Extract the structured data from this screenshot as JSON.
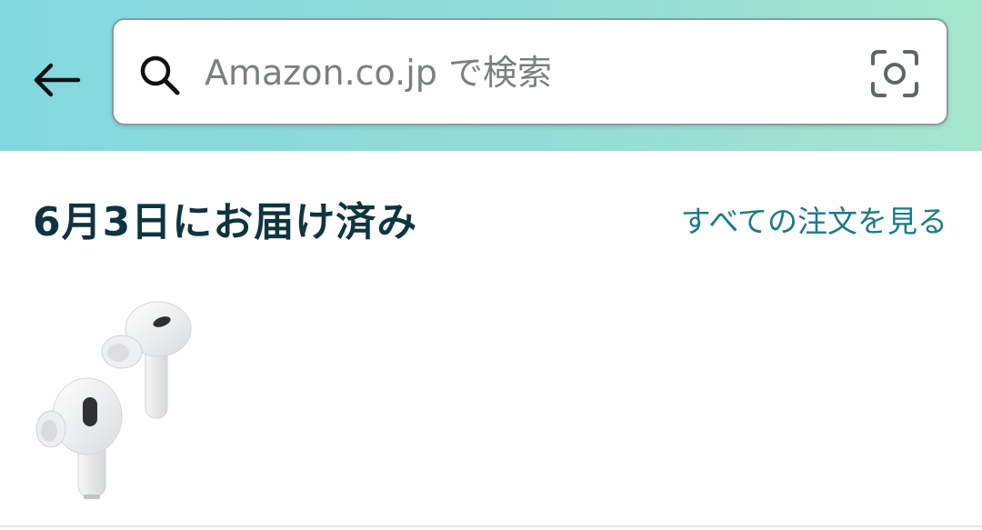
{
  "header": {
    "back_icon": "arrow-left-icon",
    "search": {
      "placeholder": "Amazon.co.jp で検索",
      "value": "",
      "search_icon": "magnifier-icon",
      "camera_icon": "camera-scan-icon"
    },
    "gradient_colors": [
      "#82d8df",
      "#a5e6cd"
    ]
  },
  "delivery": {
    "title": "6月3日にお届け済み",
    "all_orders_link": "すべての注文を見る",
    "title_color": "#0f3440",
    "link_color": "#1b7a86"
  },
  "product": {
    "image": "wireless-earbuds-image"
  }
}
